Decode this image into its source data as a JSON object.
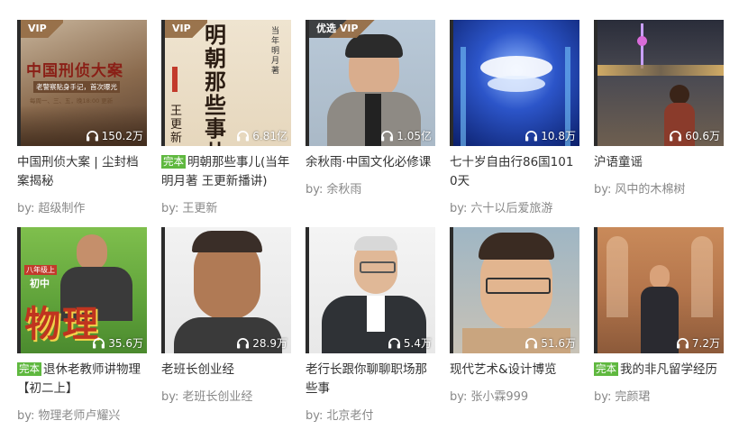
{
  "cards": [
    {
      "tag": "VIP",
      "plays": "150.2万",
      "complete": "",
      "title": "中国刑侦大案 | 尘封档案揭秘",
      "by": "by:",
      "author": "超级制作",
      "cover_text": "中国刑侦大案",
      "cover_sub": "老警察贴身手记，首次曝光",
      "cover_time": "每周一、三、五，晚18:00 更新"
    },
    {
      "tag": "VIP",
      "plays": "6.81亿",
      "complete": "完本",
      "title": "明朝那些事儿(当年明月著 王更新播讲)",
      "by": "by:",
      "author": "王更新",
      "cover_text": "明朝那些事儿",
      "cover_author": "当年明月 著",
      "cover_narrator": "王更新"
    },
    {
      "tag": "优选 VIP",
      "plays": "1.05亿",
      "complete": "",
      "title": "余秋雨·中国文化必修课",
      "by": "by:",
      "author": "余秋雨"
    },
    {
      "tag": "",
      "plays": "10.8万",
      "complete": "",
      "title": "七十岁自由行86国1010天",
      "by": "by:",
      "author": "六十以后爱旅游"
    },
    {
      "tag": "",
      "plays": "60.6万",
      "complete": "",
      "title": "沪语童谣",
      "by": "by:",
      "author": "风中的木棉树"
    },
    {
      "tag": "",
      "plays": "35.6万",
      "complete": "完本",
      "title": "退休老教师讲物理【初二上】",
      "by": "by:",
      "author": "物理老师卢耀兴",
      "cover_grade": "八年级上",
      "cover_level": "初中",
      "cover_text": "物理"
    },
    {
      "tag": "",
      "plays": "28.9万",
      "complete": "",
      "title": "老班长创业经",
      "by": "by:",
      "author": "老班长创业经"
    },
    {
      "tag": "",
      "plays": "5.4万",
      "complete": "",
      "title": "老行长跟你聊聊职场那些事",
      "by": "by:",
      "author": "北京老付"
    },
    {
      "tag": "",
      "plays": "51.6万",
      "complete": "",
      "title": "现代艺术&设计博览",
      "by": "by:",
      "author": "张小霖999"
    },
    {
      "tag": "",
      "plays": "7.2万",
      "complete": "完本",
      "title": "我的非凡留学经历",
      "by": "by:",
      "author": "完颜珺"
    }
  ]
}
